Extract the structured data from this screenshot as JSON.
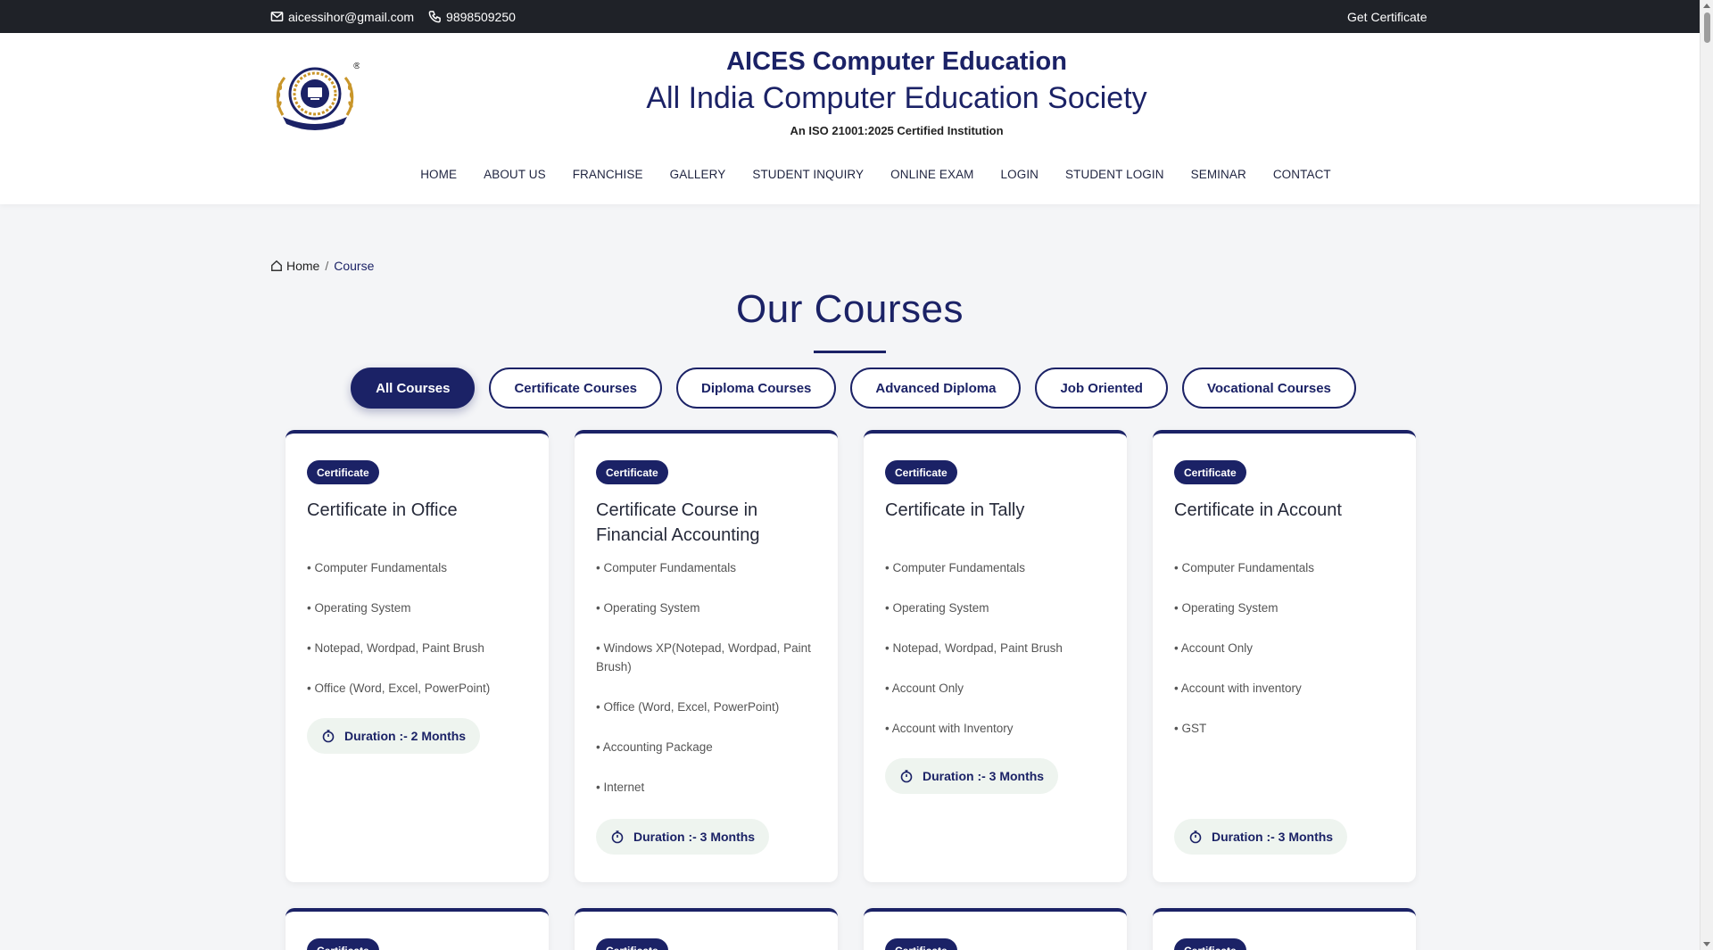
{
  "topbar": {
    "email": "aicessihor@gmail.com",
    "phone": "9898509250",
    "get_certificate": "Get Certificate"
  },
  "header": {
    "title": "AICES Computer Education",
    "subtitle": "All India Computer Education Society",
    "iso": "An ISO 21001:2025 Certified Institution",
    "logo_text": "AICES",
    "registered_mark": "®"
  },
  "nav": [
    {
      "label": "HOME"
    },
    {
      "label": "ABOUT US"
    },
    {
      "label": "FRANCHISE"
    },
    {
      "label": "GALLERY"
    },
    {
      "label": "STUDENT INQUIRY"
    },
    {
      "label": "ONLINE EXAM"
    },
    {
      "label": "LOGIN"
    },
    {
      "label": "STUDENT LOGIN"
    },
    {
      "label": "SEMINAR"
    },
    {
      "label": "CONTACT"
    }
  ],
  "breadcrumb": {
    "home": "Home",
    "separator": "/",
    "current": "Course"
  },
  "page_title": "Our Courses",
  "filters": [
    {
      "label": "All Courses",
      "active": true
    },
    {
      "label": "Certificate Courses",
      "active": false
    },
    {
      "label": "Diploma Courses",
      "active": false
    },
    {
      "label": "Advanced Diploma",
      "active": false
    },
    {
      "label": "Job Oriented",
      "active": false
    },
    {
      "label": "Vocational Courses",
      "active": false
    }
  ],
  "courses": [
    {
      "badge": "Certificate",
      "title": "Certificate in Office",
      "topics": [
        "Computer Fundamentals",
        "Operating System",
        "Notepad, Wordpad, Paint Brush",
        "Office (Word, Excel, PowerPoint)"
      ],
      "duration": "Duration :- 2 Months"
    },
    {
      "badge": "Certificate",
      "title": "Certificate Course in Financial Accounting",
      "topics": [
        "Computer Fundamentals",
        "Operating System",
        "Windows XP(Notepad, Wordpad, Paint Brush)",
        "Office (Word, Excel, PowerPoint)",
        "Accounting Package",
        "Internet"
      ],
      "duration": "Duration :- 3 Months"
    },
    {
      "badge": "Certificate",
      "title": "Certificate in Tally",
      "topics": [
        "Computer Fundamentals",
        "Operating System",
        "Notepad, Wordpad, Paint Brush",
        "Account Only",
        "Account with Inventory"
      ],
      "duration": "Duration :- 3 Months"
    },
    {
      "badge": "Certificate",
      "title": "Certificate in Account",
      "topics": [
        "Computer Fundamentals",
        "Operating System",
        "Account Only",
        "Account with inventory",
        "GST"
      ],
      "duration": "Duration :- 3 Months"
    }
  ],
  "next_row_badges": [
    "Certificate",
    "Certificate",
    "Certificate",
    "Certificate"
  ],
  "colors": {
    "primary": "#1b2266",
    "topbar": "#1f2228",
    "background": "#f4f5f7",
    "duration_bg": "#eef4ef"
  }
}
